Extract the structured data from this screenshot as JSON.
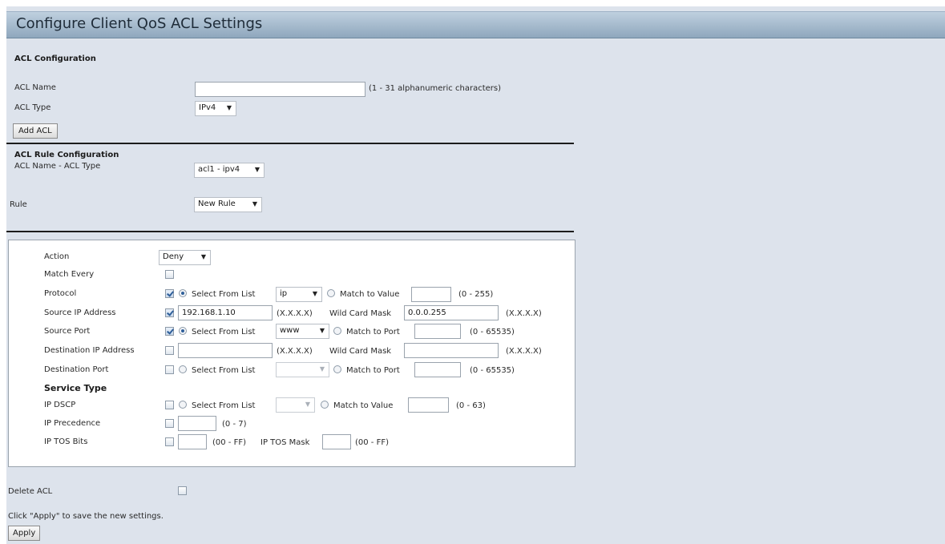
{
  "title": "Configure Client QoS ACL Settings",
  "acl_config": {
    "heading": "ACL Configuration",
    "name_label": "ACL Name",
    "name_value": "",
    "name_hint": "(1 - 31 alphanumeric characters)",
    "type_label": "ACL Type",
    "type_value": "IPv4",
    "add_button": "Add ACL"
  },
  "rule_config": {
    "heading": "ACL Rule Configuration",
    "name_type_label": "ACL Name - ACL Type",
    "name_type_value": "acl1 - ipv4",
    "rule_label": "Rule",
    "rule_value": "New Rule"
  },
  "rule": {
    "action": {
      "label": "Action",
      "value": "Deny"
    },
    "match_every": {
      "label": "Match Every",
      "checked": false
    },
    "protocol": {
      "label": "Protocol",
      "checked": true,
      "select_label": "Select From List",
      "select_value": "ip",
      "match_label": "Match to Value",
      "match_value": "",
      "range": "(0 - 255)"
    },
    "source_ip": {
      "label": "Source IP Address",
      "checked": true,
      "value": "192.168.1.10",
      "format": "(X.X.X.X)",
      "mask_label": "Wild Card Mask",
      "mask_value": "0.0.0.255",
      "mask_format": "(X.X.X.X)"
    },
    "source_port": {
      "label": "Source Port",
      "checked": true,
      "select_label": "Select From List",
      "select_value": "www",
      "match_label": "Match to Port",
      "match_value": "",
      "range": "(0 - 65535)"
    },
    "dest_ip": {
      "label": "Destination IP Address",
      "checked": false,
      "value": "",
      "format": "(X.X.X.X)",
      "mask_label": "Wild Card Mask",
      "mask_value": "",
      "mask_format": "(X.X.X.X)"
    },
    "dest_port": {
      "label": "Destination Port",
      "checked": false,
      "select_label": "Select From List",
      "select_value": "",
      "match_label": "Match to Port",
      "match_value": "",
      "range": "(0 - 65535)"
    },
    "service_type": {
      "heading": "Service Type"
    },
    "ip_dscp": {
      "label": "IP DSCP",
      "checked": false,
      "select_label": "Select From List",
      "select_value": "",
      "match_label": "Match to Value",
      "match_value": "",
      "range": "(0 - 63)"
    },
    "ip_precedence": {
      "label": "IP Precedence",
      "checked": false,
      "value": "",
      "range": "(0 - 7)"
    },
    "ip_tos": {
      "label": "IP TOS Bits",
      "checked": false,
      "value": "",
      "range": "(00 - FF)",
      "mask_label": "IP TOS Mask",
      "mask_value": "",
      "mask_range": "(00 - FF)"
    }
  },
  "delete_acl": {
    "label": "Delete ACL",
    "checked": false
  },
  "footer": {
    "note": "Click \"Apply\" to save the new settings.",
    "apply_button": "Apply"
  },
  "colors": {
    "title_bar": "#a9bccd",
    "panel_bg": "#dde3ec",
    "accent": "#2f5f9a"
  }
}
